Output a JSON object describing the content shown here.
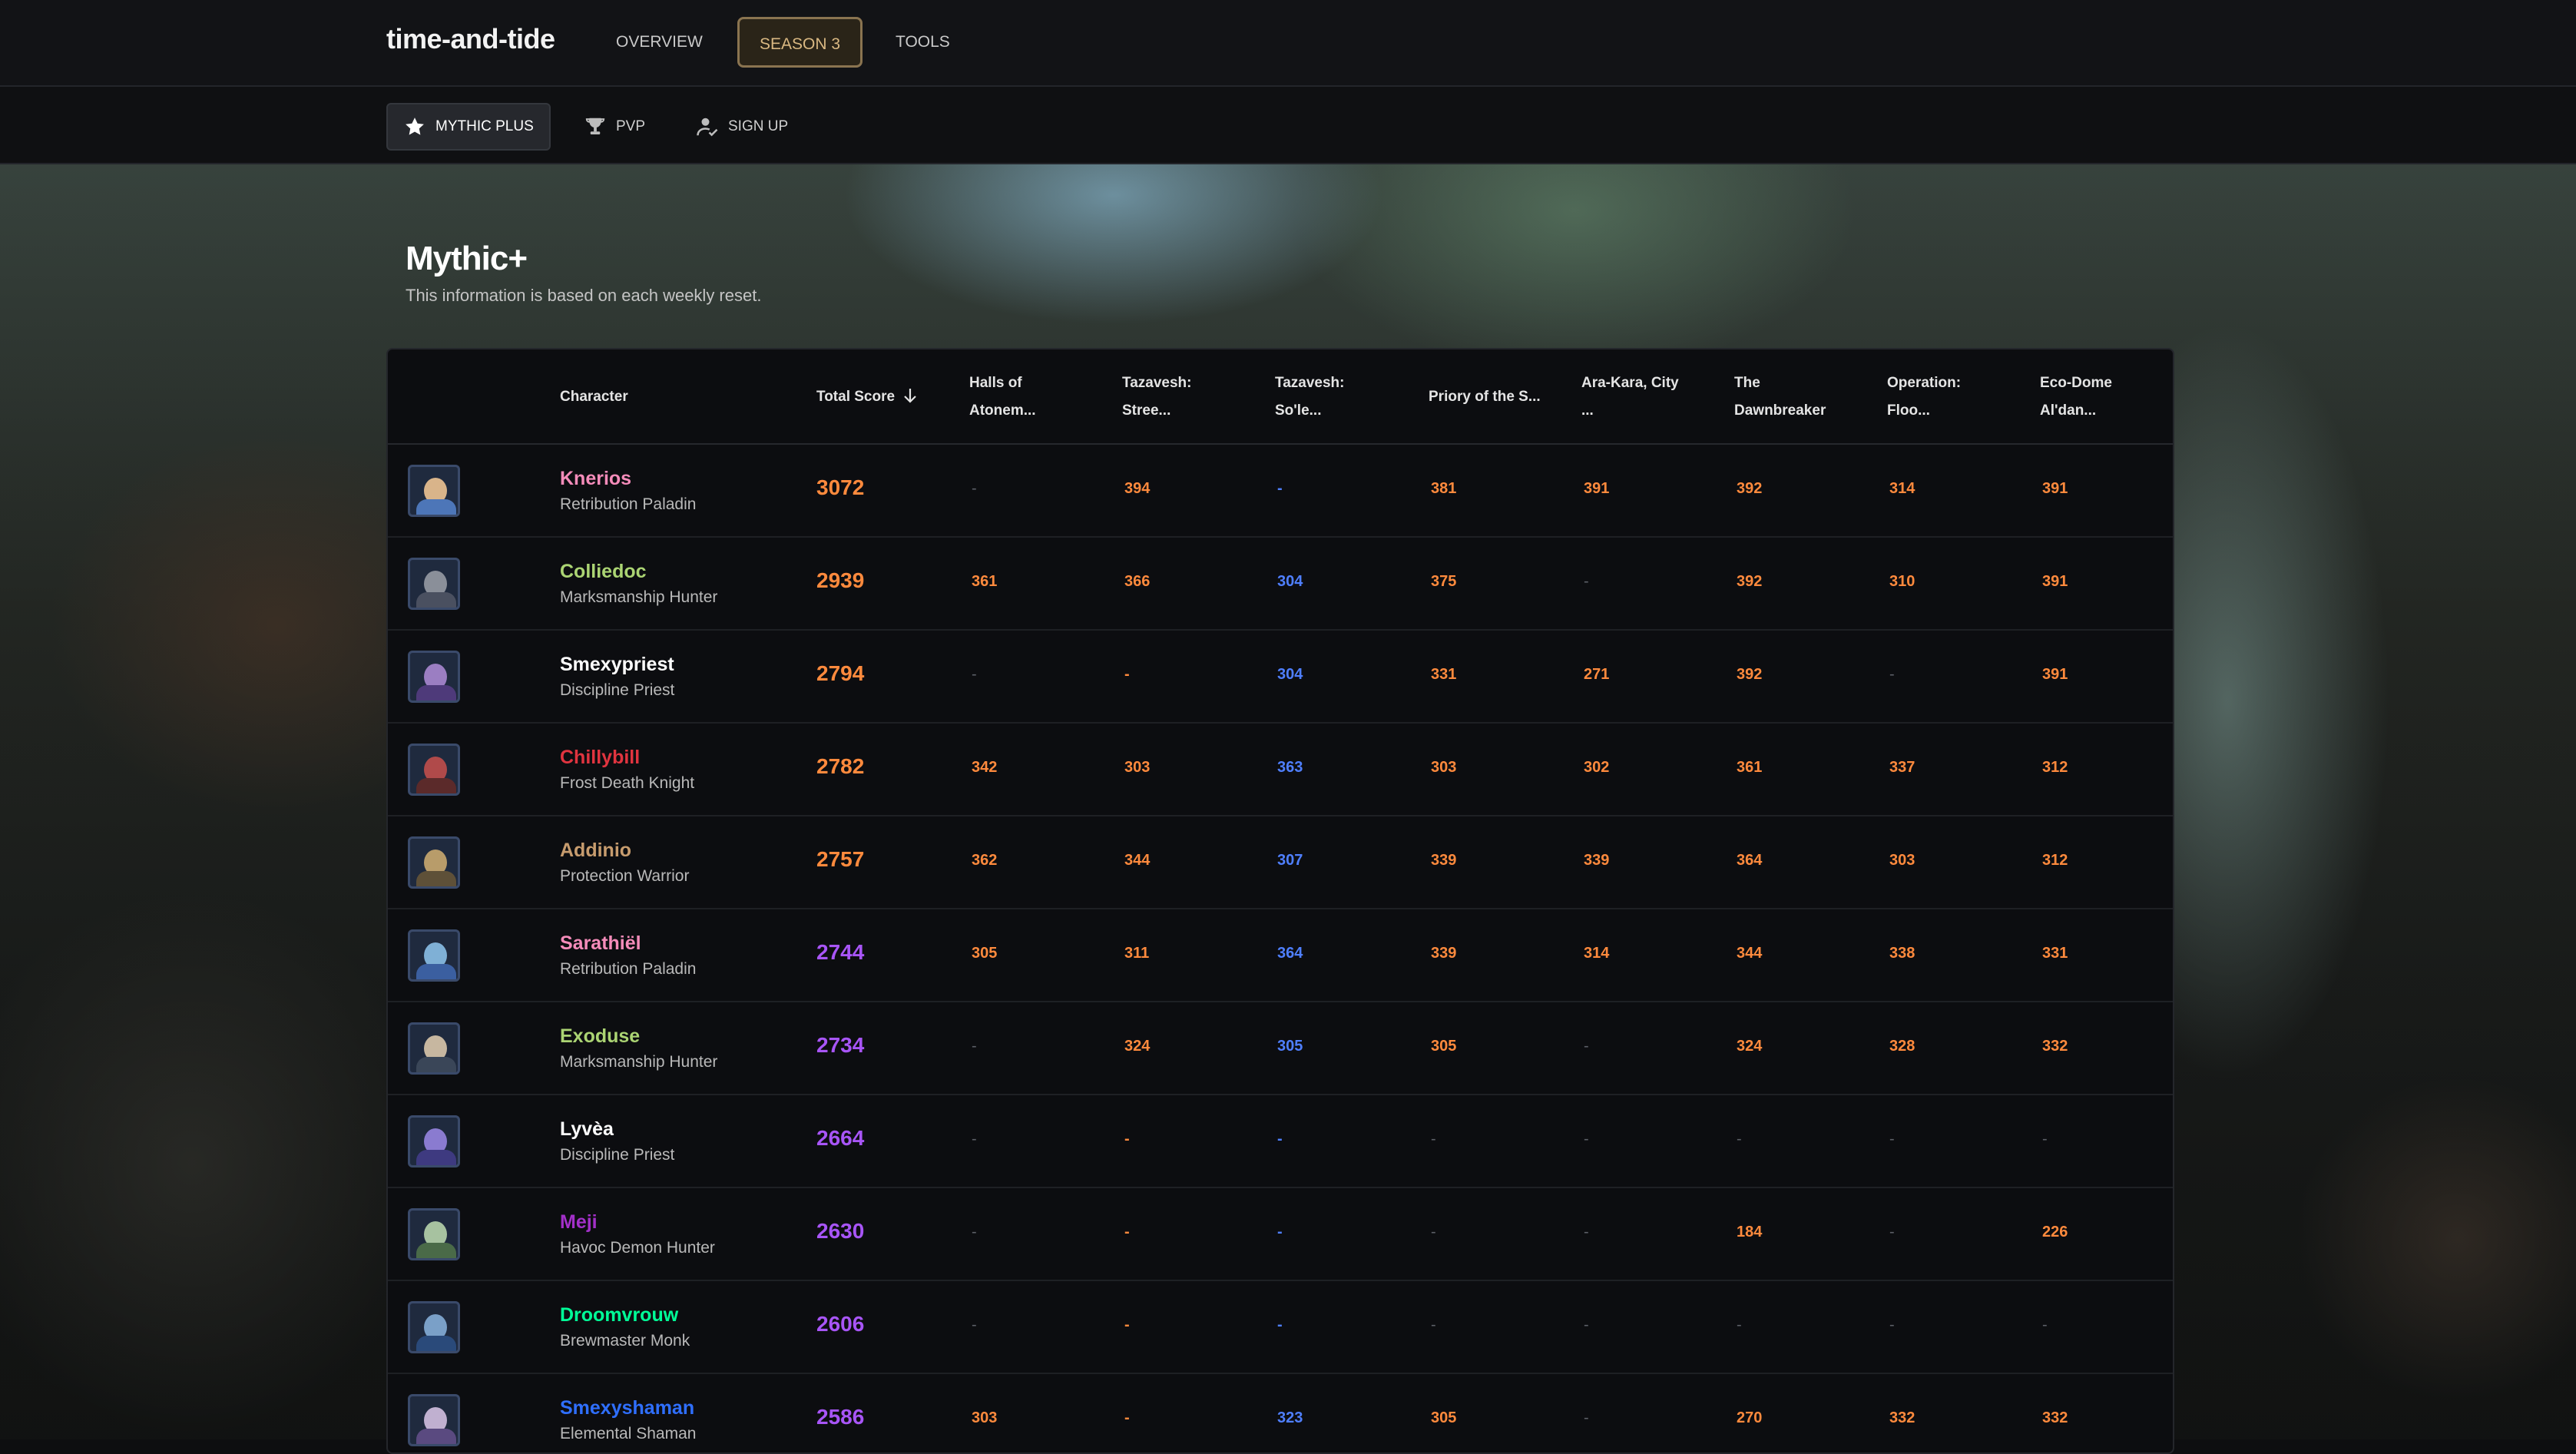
{
  "nav": {
    "brand": "time-and-tide",
    "links": [
      "OVERVIEW",
      "SEASON 3",
      "TOOLS"
    ],
    "active": 1
  },
  "subnav": {
    "tabs": [
      {
        "label": "MYTHIC PLUS",
        "icon": "star-icon"
      },
      {
        "label": "PVP",
        "icon": "trophy-icon"
      },
      {
        "label": "SIGN UP",
        "icon": "user-check-icon"
      }
    ],
    "active": 0
  },
  "page": {
    "title": "Mythic+",
    "subtitle": "This information is based on each weekly reset."
  },
  "table": {
    "columns": [
      "Character",
      "Total Score",
      "Halls of Atonem...",
      "Tazavesh: Stree...",
      "Tazavesh: So'le...",
      "Priory of the S...",
      "Ara-Kara, City ...",
      "The Dawnbreaker",
      "Operation: Floo...",
      "Eco-Dome Al'dan..."
    ],
    "header_lines": [
      [
        "Character"
      ],
      [
        "Total Score"
      ],
      [
        "Halls of",
        "Atonem..."
      ],
      [
        "Tazavesh:",
        "Stree..."
      ],
      [
        "Tazavesh:",
        "So'le..."
      ],
      [
        "Priory of the S..."
      ],
      [
        "Ara-Kara, City",
        "..."
      ],
      [
        "The",
        "Dawnbreaker"
      ],
      [
        "Operation:",
        "Floo..."
      ],
      [
        "Eco-Dome",
        "Al'dan..."
      ]
    ],
    "sort_icon": "arrow-down-icon",
    "rows": [
      {
        "name": "Knerios",
        "spec": "Retribution Paladin",
        "name_color": "#f58cba",
        "total": "3072",
        "total_color": "#ff8a3d",
        "scores": [
          "-",
          "394",
          "-",
          "381",
          "391",
          "392",
          "314",
          "391"
        ]
      },
      {
        "name": "Colliedoc",
        "spec": "Marksmanship Hunter",
        "name_color": "#abd473",
        "total": "2939",
        "total_color": "#ff8a3d",
        "scores": [
          "361",
          "366",
          "304",
          "375",
          "-",
          "392",
          "310",
          "391"
        ]
      },
      {
        "name": "Smexypriest",
        "spec": "Discipline Priest",
        "name_color": "#ffffff",
        "total": "2794",
        "total_color": "#ff8a3d",
        "scores": [
          "-",
          "-",
          "304",
          "331",
          "271",
          "392",
          "-",
          "391"
        ]
      },
      {
        "name": "Chillybill",
        "spec": "Frost Death Knight",
        "name_color": "#e0343f",
        "total": "2782",
        "total_color": "#ff8a3d",
        "scores": [
          "342",
          "303",
          "363",
          "303",
          "302",
          "361",
          "337",
          "312"
        ]
      },
      {
        "name": "Addinio",
        "spec": "Protection Warrior",
        "name_color": "#c79c6e",
        "total": "2757",
        "total_color": "#ff8a3d",
        "scores": [
          "362",
          "344",
          "307",
          "339",
          "339",
          "364",
          "303",
          "312"
        ]
      },
      {
        "name": "Sarathiël",
        "spec": "Retribution Paladin",
        "name_color": "#f58cba",
        "total": "2744",
        "total_color": "#a855f7",
        "scores": [
          "305",
          "311",
          "364",
          "339",
          "314",
          "344",
          "338",
          "331"
        ]
      },
      {
        "name": "Exoduse",
        "spec": "Marksmanship Hunter",
        "name_color": "#abd473",
        "total": "2734",
        "total_color": "#a855f7",
        "scores": [
          "-",
          "324",
          "305",
          "305",
          "-",
          "324",
          "328",
          "332"
        ]
      },
      {
        "name": "Lyvèa",
        "spec": "Discipline Priest",
        "name_color": "#ffffff",
        "total": "2664",
        "total_color": "#a855f7",
        "scores": [
          "-",
          "-",
          "-",
          "-",
          "-",
          "-",
          "-",
          "-"
        ]
      },
      {
        "name": "Meji",
        "spec": "Havoc Demon Hunter",
        "name_color": "#a330c9",
        "total": "2630",
        "total_color": "#a855f7",
        "scores": [
          "-",
          "-",
          "-",
          "-",
          "-",
          "184",
          "-",
          "226"
        ]
      },
      {
        "name": "Droomvrouw",
        "spec": "Brewmaster Monk",
        "name_color": "#00ff98",
        "total": "2606",
        "total_color": "#a855f7",
        "scores": [
          "-",
          "-",
          "-",
          "-",
          "-",
          "-",
          "-",
          "-"
        ]
      },
      {
        "name": "Smexyshaman",
        "spec": "Elemental Shaman",
        "name_color": "#2f6fff",
        "total": "2586",
        "total_color": "#a855f7",
        "scores": [
          "303",
          "-",
          "323",
          "305",
          "-",
          "270",
          "332",
          "332"
        ]
      }
    ],
    "score_colors": {
      "orange": "#ff8a3d",
      "blue": "#4f7fff",
      "dim": "#5d6068"
    }
  }
}
